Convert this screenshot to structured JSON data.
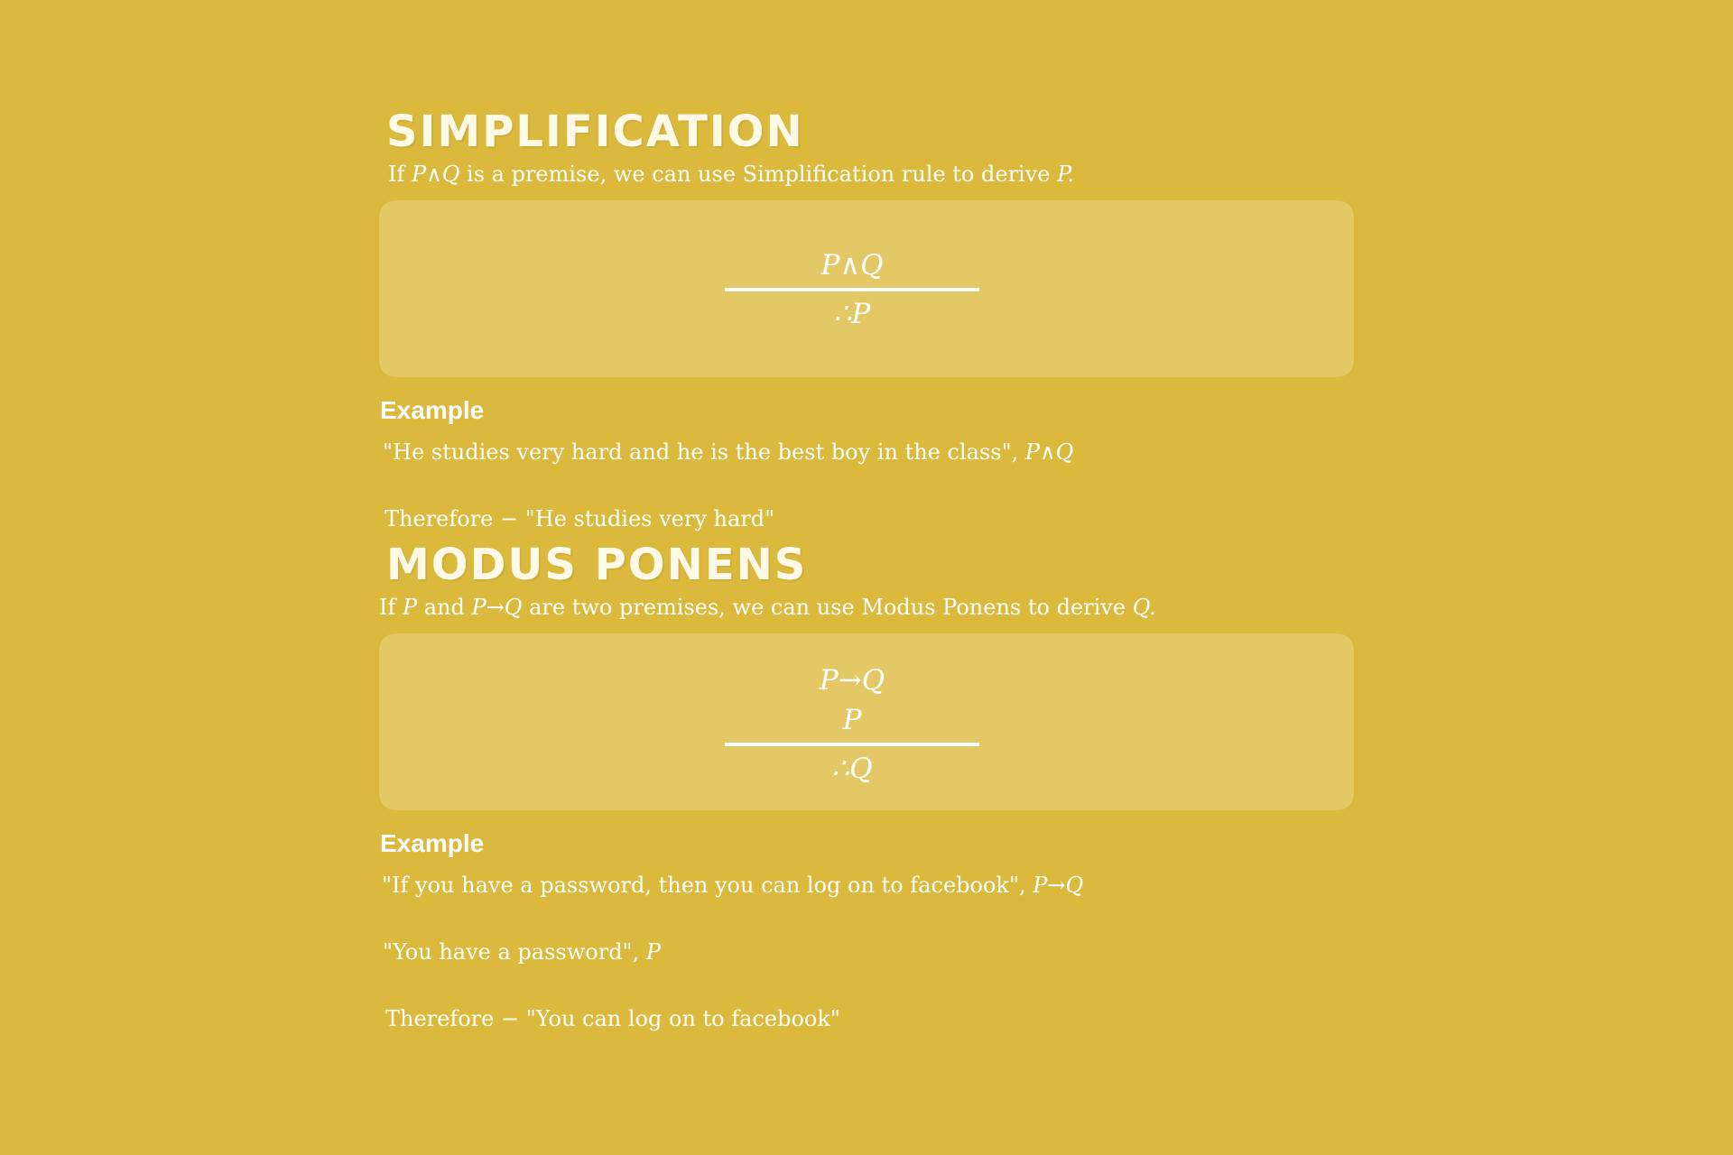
{
  "simplification": {
    "title": "Simplification",
    "intro_prefix": "If ",
    "intro_premise": "P∧Q",
    "intro_mid": " is a premise, we can use Simplification rule to derive ",
    "intro_conclusion": "P.",
    "rule_premise": "P∧Q",
    "rule_conclusion": "∴P",
    "example_title": "Example",
    "example_line1_text": "\"He studies very hard and he is the best boy in the class\", ",
    "example_line1_sym": "P∧Q",
    "example_line2_text": "Therefore − \"He studies very hard\""
  },
  "modus_ponens": {
    "title": "Modus Ponens",
    "intro_prefix": "If ",
    "intro_p": "P",
    "intro_and": " and ",
    "intro_pq": "P→Q",
    "intro_mid": " are two premises, we can use Modus Ponens to derive ",
    "intro_conclusion": "Q.",
    "rule_premise1": "P→Q",
    "rule_premise2": "P",
    "rule_conclusion": "∴Q",
    "example_title": "Example",
    "example_line1_text": "\"If you have a password, then you can log on to facebook\",  ",
    "example_line1_sym": "P→Q",
    "example_line2_text": "\"You have a password\", ",
    "example_line2_sym": "P",
    "example_line3_text": "Therefore − \"You can log on to facebook\""
  }
}
